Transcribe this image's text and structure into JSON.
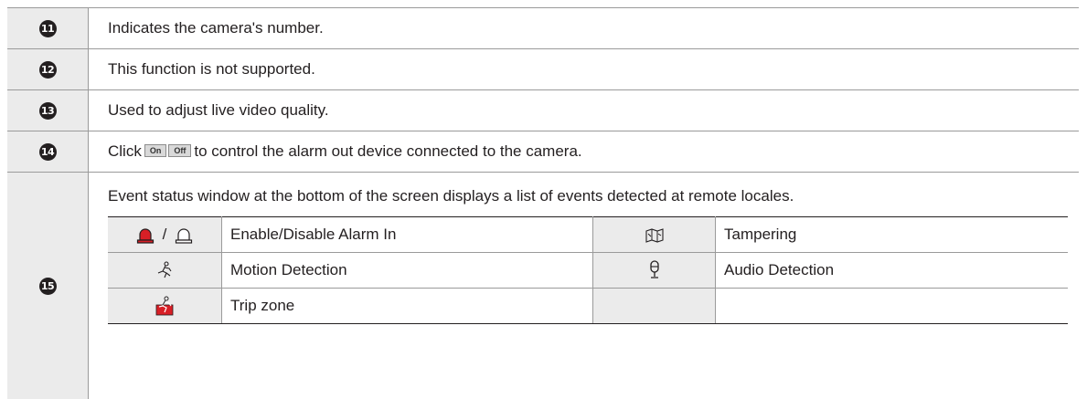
{
  "rows": [
    {
      "num": "11",
      "text": "Indicates the camera's number."
    },
    {
      "num": "12",
      "text": "This function is not supported."
    },
    {
      "num": "13",
      "text": "Used to adjust live video quality."
    },
    {
      "num": "14",
      "text_before": "Click",
      "on_label": "On",
      "off_label": "Off",
      "text_after": "to control the alarm out device connected to the camera."
    },
    {
      "num": "15",
      "text": "Event status window at the bottom of the screen displays a list of events detected at remote locales."
    }
  ],
  "events": {
    "alarm_separator": "/",
    "items": [
      {
        "icon": "alarm-in-icon",
        "label": "Enable/Disable Alarm In"
      },
      {
        "icon": "tampering-icon",
        "label": "Tampering"
      },
      {
        "icon": "motion-detection-icon",
        "label": "Motion Detection"
      },
      {
        "icon": "audio-detection-icon",
        "label": "Audio Detection"
      },
      {
        "icon": "trip-zone-icon",
        "label": "Trip zone"
      }
    ]
  },
  "colors": {
    "alarm_enabled": "#d81f26",
    "trip_zone": "#d81f26",
    "header_fill": "#ebebeb"
  }
}
